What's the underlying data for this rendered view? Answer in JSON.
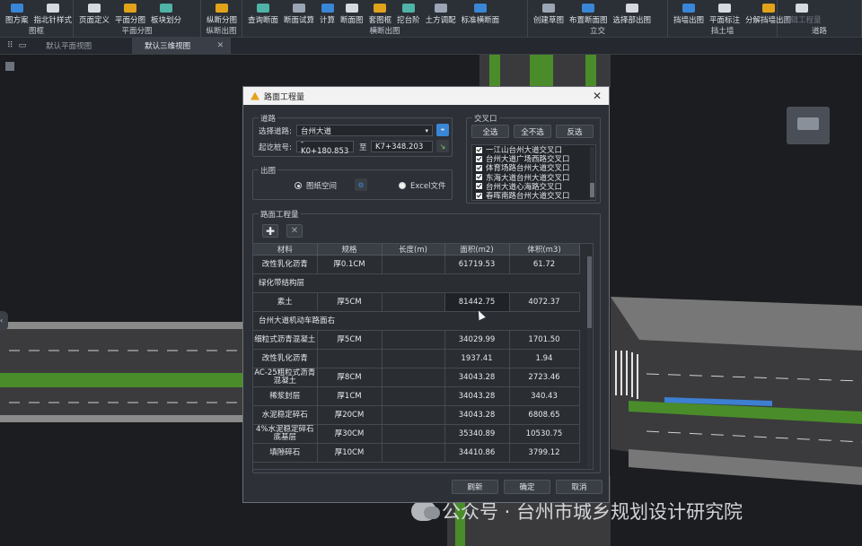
{
  "ribbon": {
    "groups": [
      {
        "name": "图框",
        "buttons": [
          "图方案",
          "指北针样式"
        ]
      },
      {
        "name": "平面分图",
        "buttons": [
          "页面定义",
          "平面分图",
          "板块划分"
        ]
      },
      {
        "name": "纵断出图",
        "buttons": [
          "纵断分图"
        ]
      },
      {
        "name": "横断出图",
        "buttons": [
          "查询断面",
          "断面试算",
          "计算",
          "断面图",
          "套图框",
          "挖台阶",
          "土方调配",
          "标准横断面"
        ]
      },
      {
        "name": "立交",
        "buttons": [
          "创建草图",
          "布置断面图",
          "选择部出图"
        ]
      },
      {
        "name": "挡土墙",
        "buttons": [
          "挡墙出图",
          "平面标注",
          "分解挡墙出图"
        ]
      },
      {
        "name": "道路",
        "buttons": [
          "编辑工程量"
        ]
      }
    ]
  },
  "tabs": {
    "items": [
      "默认平面视图",
      "默认三维视图"
    ],
    "active": "默认三维视图"
  },
  "dialog": {
    "title": "路面工程量",
    "road_section": {
      "legend": "道路",
      "select_label": "选择道路:",
      "road_value": "台州大道",
      "station_label": "起讫桩号:",
      "from": "-K0+180.853",
      "to_label": "至",
      "to": "K7+348.203"
    },
    "intersections": {
      "legend": "交叉口",
      "select_all": "全选",
      "select_none": "全不选",
      "invert": "反选",
      "items": [
        "一江山台州大道交叉口",
        "台州大道广场西路交叉口",
        "体育场路台州大道交叉口",
        "东海大道台州大道交叉口",
        "台州大道心海路交叉口",
        "春晖南路台州大道交叉口"
      ]
    },
    "output": {
      "legend": "出图",
      "paper_space": "图纸空间",
      "excel": "Excel文件"
    },
    "quantities": {
      "legend": "路面工程量",
      "columns": [
        "材料",
        "规格",
        "长度(m)",
        "面积(m2)",
        "体积(m3)"
      ],
      "rows": [
        {
          "type": "data",
          "cells": [
            "改性乳化沥青",
            "厚0.1CM",
            "",
            "61719.53",
            "61.72"
          ]
        },
        {
          "type": "group",
          "label": "绿化带结构层"
        },
        {
          "type": "data",
          "cells": [
            "素土",
            "厚5CM",
            "",
            "81442.75",
            "4072.37"
          ]
        },
        {
          "type": "group",
          "label": "台州大道机动车路面右"
        },
        {
          "type": "data",
          "cells": [
            "细粒式沥青混凝土",
            "厚5CM",
            "",
            "34029.99",
            "1701.50"
          ]
        },
        {
          "type": "data",
          "cells": [
            "改性乳化沥青",
            "",
            "",
            "1937.41",
            "1.94"
          ]
        },
        {
          "type": "data",
          "cells": [
            "AC-25粗粒式沥青混凝土",
            "厚8CM",
            "",
            "34043.28",
            "2723.46"
          ]
        },
        {
          "type": "data",
          "cells": [
            "稀浆封层",
            "厚1CM",
            "",
            "34043.28",
            "340.43"
          ]
        },
        {
          "type": "data",
          "cells": [
            "水泥稳定碎石",
            "厚20CM",
            "",
            "34043.28",
            "6808.65"
          ]
        },
        {
          "type": "data",
          "cells": [
            "4%水泥稳定碎石底基层",
            "厚30CM",
            "",
            "35340.89",
            "10530.75"
          ]
        },
        {
          "type": "data",
          "cells": [
            "填隙碎石",
            "厚10CM",
            "",
            "34410.86",
            "3799.12"
          ]
        }
      ]
    },
    "buttons": {
      "refresh": "刷新",
      "ok": "确定",
      "cancel": "取消"
    }
  },
  "watermark": {
    "text": "公众号 · 台州市城乡规划设计研究院"
  },
  "colors": {
    "accent": "#3a86d6",
    "road": "#3b3b3d",
    "green_belt": "#4a8c2a",
    "background": "#1b1d20"
  }
}
